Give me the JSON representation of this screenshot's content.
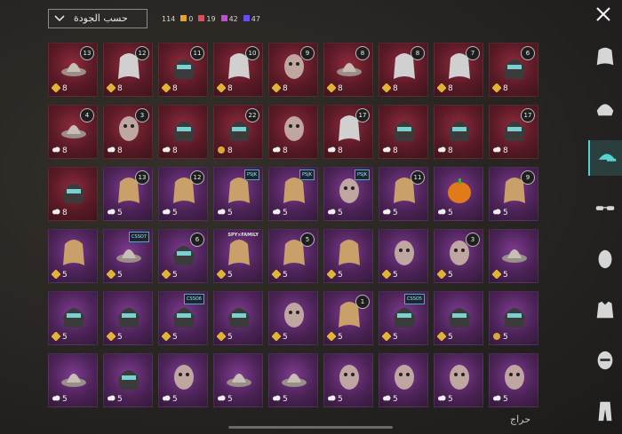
{
  "header": {
    "sort_label": "حسب الجودة",
    "total": "114",
    "counts": [
      {
        "value": "0",
        "color": "#f0a020"
      },
      {
        "value": "19",
        "color": "#e54b57"
      },
      {
        "value": "42",
        "color": "#c54ad8"
      },
      {
        "value": "47",
        "color": "#6a4cf0"
      }
    ]
  },
  "items": [
    {
      "rarity": "red",
      "level": "13",
      "value": "8",
      "badge": "medal",
      "kind": "hat"
    },
    {
      "rarity": "red",
      "level": "12",
      "value": "8",
      "badge": "medal",
      "kind": "hair"
    },
    {
      "rarity": "red",
      "level": "11",
      "value": "8",
      "badge": "medal",
      "kind": "helmet"
    },
    {
      "rarity": "red",
      "level": "10",
      "value": "8",
      "badge": "medal",
      "kind": "hair"
    },
    {
      "rarity": "red",
      "level": "9",
      "value": "8",
      "badge": "medal",
      "kind": "mask"
    },
    {
      "rarity": "red",
      "level": "8",
      "value": "8",
      "badge": "medal",
      "kind": "hat"
    },
    {
      "rarity": "red",
      "level": "8",
      "value": "8",
      "badge": "medal",
      "kind": "hair"
    },
    {
      "rarity": "red",
      "level": "7",
      "value": "8",
      "badge": "medal",
      "kind": "hair"
    },
    {
      "rarity": "red",
      "level": "6",
      "value": "8",
      "badge": "medal",
      "kind": "helmet"
    },
    {
      "rarity": "red",
      "level": "4",
      "value": "8",
      "badge": "cloud",
      "kind": "hat"
    },
    {
      "rarity": "red",
      "level": "3",
      "value": "8",
      "badge": "cloud",
      "kind": "mask"
    },
    {
      "rarity": "red",
      "level": "",
      "value": "8",
      "badge": "cloud",
      "kind": "helmet"
    },
    {
      "rarity": "red",
      "level": "22",
      "value": "8",
      "badge": "coin",
      "kind": "helmet"
    },
    {
      "rarity": "red",
      "level": "",
      "value": "8",
      "badge": "cloud",
      "kind": "mask"
    },
    {
      "rarity": "red",
      "level": "17",
      "value": "8",
      "badge": "cloud",
      "kind": "hair"
    },
    {
      "rarity": "red",
      "level": "",
      "value": "8",
      "badge": "cloud",
      "kind": "helmet"
    },
    {
      "rarity": "red",
      "level": "",
      "value": "8",
      "badge": "cloud",
      "kind": "helmet"
    },
    {
      "rarity": "red",
      "level": "17",
      "value": "8",
      "badge": "cloud",
      "kind": "helmet"
    },
    {
      "rarity": "red",
      "level": "",
      "value": "8",
      "badge": "cloud",
      "kind": "helmet"
    },
    {
      "rarity": "purple",
      "level": "13",
      "value": "5",
      "badge": "cloud",
      "kind": "hair"
    },
    {
      "rarity": "purple",
      "level": "12",
      "value": "5",
      "badge": "cloud",
      "kind": "hair"
    },
    {
      "rarity": "purple",
      "level": "",
      "tag": "PSJK",
      "value": "5",
      "badge": "cloud",
      "kind": "hair"
    },
    {
      "rarity": "purple",
      "level": "",
      "tag": "PSJK",
      "value": "5",
      "badge": "cloud",
      "kind": "hair"
    },
    {
      "rarity": "purple",
      "level": "",
      "tag": "PSJK",
      "value": "5",
      "badge": "cloud",
      "kind": "mask"
    },
    {
      "rarity": "purple",
      "level": "11",
      "value": "5",
      "badge": "cloud",
      "kind": "hair"
    },
    {
      "rarity": "purple",
      "level": "",
      "value": "5",
      "badge": "cloud",
      "kind": "pumpkin"
    },
    {
      "rarity": "purple",
      "level": "9",
      "value": "5",
      "badge": "cloud",
      "kind": "hair"
    },
    {
      "rarity": "purple",
      "level": "",
      "value": "5",
      "badge": "medal",
      "kind": "hair"
    },
    {
      "rarity": "purple",
      "level": "",
      "tag": "CSSO7",
      "value": "5",
      "badge": "medal",
      "kind": "hat"
    },
    {
      "rarity": "purple",
      "level": "6",
      "value": "5",
      "badge": "medal",
      "kind": "helmet"
    },
    {
      "rarity": "purple",
      "level": "",
      "label": "SPY×FAMILY",
      "value": "5",
      "badge": "medal",
      "kind": "hair"
    },
    {
      "rarity": "purple",
      "level": "5",
      "value": "5",
      "badge": "medal",
      "kind": "hair"
    },
    {
      "rarity": "purple",
      "level": "",
      "value": "5",
      "badge": "medal",
      "kind": "hair"
    },
    {
      "rarity": "purple",
      "level": "",
      "value": "5",
      "badge": "medal",
      "kind": "mask"
    },
    {
      "rarity": "purple",
      "level": "3",
      "value": "5",
      "badge": "medal",
      "kind": "mask"
    },
    {
      "rarity": "purple",
      "level": "",
      "value": "5",
      "badge": "medal",
      "kind": "hat"
    },
    {
      "rarity": "purple",
      "level": "",
      "value": "5",
      "badge": "medal",
      "kind": "helmet"
    },
    {
      "rarity": "purple",
      "level": "",
      "value": "5",
      "badge": "medal",
      "kind": "helmet"
    },
    {
      "rarity": "purple",
      "level": "",
      "tag": "CSSO6",
      "value": "5",
      "badge": "medal",
      "kind": "helmet"
    },
    {
      "rarity": "purple",
      "level": "",
      "value": "5",
      "badge": "medal",
      "kind": "helmet"
    },
    {
      "rarity": "purple",
      "level": "",
      "value": "5",
      "badge": "medal",
      "kind": "mask"
    },
    {
      "rarity": "purple",
      "level": "1",
      "value": "5",
      "badge": "medal",
      "kind": "hair"
    },
    {
      "rarity": "purple",
      "level": "",
      "tag": "CSSO5",
      "value": "5",
      "badge": "medal",
      "kind": "helmet"
    },
    {
      "rarity": "purple",
      "level": "",
      "value": "5",
      "badge": "medal",
      "kind": "helmet"
    },
    {
      "rarity": "purple",
      "level": "",
      "value": "5",
      "badge": "coin",
      "kind": "helmet"
    },
    {
      "rarity": "purple",
      "level": "",
      "value": "5",
      "badge": "cloud",
      "kind": "hat"
    },
    {
      "rarity": "purple",
      "level": "",
      "value": "5",
      "badge": "cloud",
      "kind": "helmet"
    },
    {
      "rarity": "purple",
      "level": "",
      "value": "5",
      "badge": "cloud",
      "kind": "mask"
    },
    {
      "rarity": "purple",
      "level": "",
      "value": "5",
      "badge": "cloud",
      "kind": "hat"
    },
    {
      "rarity": "purple",
      "level": "",
      "value": "5",
      "badge": "cloud",
      "kind": "hat"
    },
    {
      "rarity": "purple",
      "level": "",
      "value": "5",
      "badge": "cloud",
      "kind": "mask"
    },
    {
      "rarity": "purple",
      "level": "",
      "value": "5",
      "badge": "cloud",
      "kind": "mask"
    },
    {
      "rarity": "purple",
      "level": "",
      "value": "5",
      "badge": "cloud",
      "kind": "mask"
    },
    {
      "rarity": "purple",
      "level": "",
      "value": "5",
      "badge": "cloud",
      "kind": "mask"
    }
  ],
  "sidebar": {
    "tabs": [
      {
        "icon": "hair-icon",
        "active": false
      },
      {
        "icon": "helmet-icon",
        "active": false
      },
      {
        "icon": "cap-icon",
        "active": true
      },
      {
        "icon": "glasses-icon",
        "active": false
      },
      {
        "icon": "face-icon",
        "active": false
      },
      {
        "icon": "jacket-icon",
        "active": false
      },
      {
        "icon": "mask-icon",
        "active": false
      },
      {
        "icon": "pants-icon",
        "active": false
      }
    ]
  },
  "watermark": "حراج"
}
